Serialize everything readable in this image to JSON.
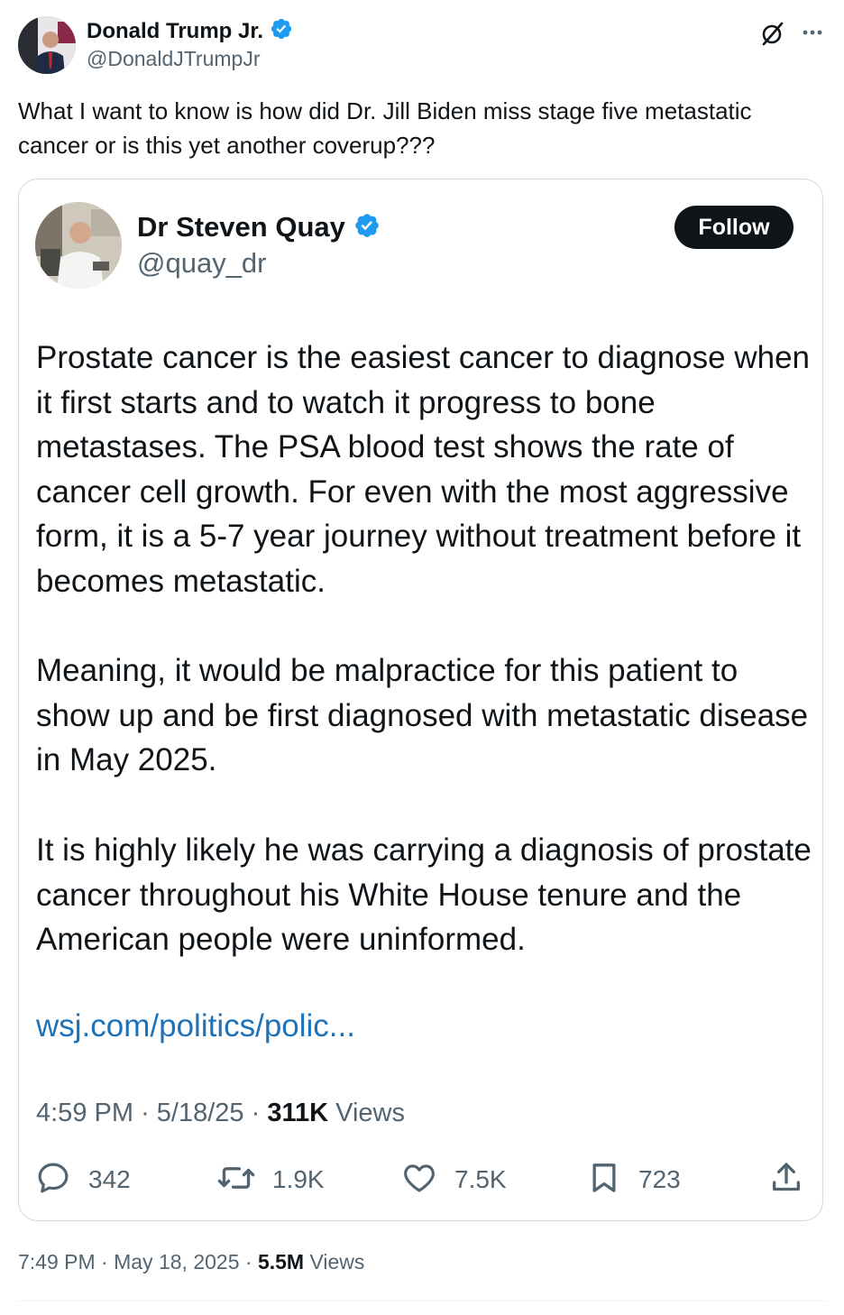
{
  "outer_tweet": {
    "author_name": "Donald Trump Jr.",
    "author_handle": "@DonaldJTrumpJr",
    "text": "What I want to know is how did Dr. Jill Biden miss stage five metastatic cancer or is this yet another coverup???",
    "time": "7:49 PM",
    "date": "May 18, 2025",
    "views_count": "5.5M",
    "views_label": "Views"
  },
  "quoted_tweet": {
    "author_name": "Dr Steven Quay",
    "author_handle": "@quay_dr",
    "follow_label": "Follow",
    "paragraphs": [
      "Prostate cancer is the easiest cancer to diagnose when it first starts and to watch it progress to bone metastases. The PSA blood test shows the rate of cancer cell growth. For even with the most aggressive form, it is a 5-7 year journey without treatment before it becomes metastatic.",
      "Meaning, it would be malpractice for this patient to show up and be first diagnosed with metastatic disease in May 2025.",
      "It is highly likely he was carrying a diagnosis of prostate cancer throughout his White House tenure and the American people were uninformed."
    ],
    "link": "wsj.com/politics/polic...",
    "time": "4:59 PM",
    "date": "5/18/25",
    "views_count": "311K",
    "views_label": "Views",
    "replies": "342",
    "reposts": "1.9K",
    "likes": "7.5K",
    "bookmarks": "723"
  },
  "colors": {
    "verified_badge": "#1d9bf0",
    "link": "#1d72b8",
    "secondary_text": "#536471",
    "follow_button": "#0f1419"
  },
  "icons": [
    "verified-badge-icon",
    "grok-icon",
    "more-icon",
    "reply-icon",
    "repost-icon",
    "like-icon",
    "bookmark-icon",
    "share-icon"
  ]
}
